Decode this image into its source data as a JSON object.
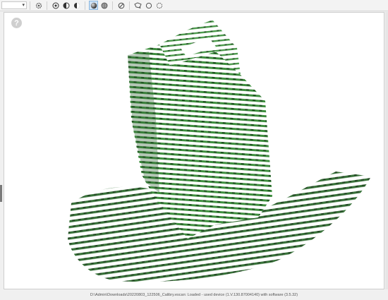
{
  "toolbar": {
    "dropdown_value": "",
    "buttons": [
      {
        "name": "settings-icon"
      },
      {
        "name": "view-mode-1-icon"
      },
      {
        "name": "view-mode-2-icon"
      },
      {
        "name": "view-mode-3-icon"
      },
      {
        "name": "shaded-sphere-icon",
        "active": true
      },
      {
        "name": "mesh-sphere-icon"
      },
      {
        "name": "no-entry-icon"
      },
      {
        "name": "lasso-select-icon"
      },
      {
        "name": "circle-select-icon"
      },
      {
        "name": "reset-view-icon"
      }
    ]
  },
  "viewport": {
    "help_label": "?",
    "scan_color": "#3a8a3a"
  },
  "status": {
    "text": "D:\\Admin\\Downloads\\20220803_122506_Calibry.escan: Loaded - used device (1.V.130.87004140) with software (3.5.32)"
  }
}
